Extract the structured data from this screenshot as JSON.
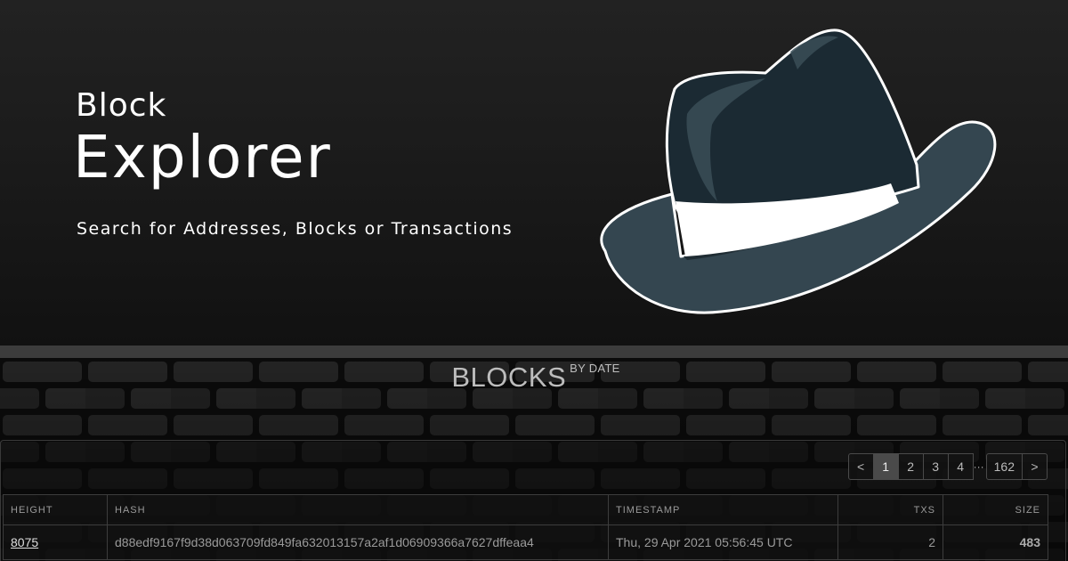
{
  "hero": {
    "title_line1": "Block",
    "title_line2": "Explorer",
    "subtitle": "Search for Addresses, Blocks or Transactions",
    "logo_icon": "fedora-hat-icon"
  },
  "blocks": {
    "heading": "BLOCKS",
    "heading_sup": "BY DATE",
    "pagination": {
      "prev": "<",
      "pages": [
        "1",
        "2",
        "3",
        "4"
      ],
      "active_page": "1",
      "ellipsis": "···",
      "last_page": "162",
      "next": ">"
    },
    "columns": {
      "height": "HEIGHT",
      "hash": "HASH",
      "timestamp": "TIMESTAMP",
      "txs": "TXS",
      "size": "SIZE"
    },
    "rows": [
      {
        "height": "8075",
        "hash": "d88edf9167f9d38d063709fd849fa632013157a2af1d06909366a7627dffeaa4",
        "timestamp": "Thu, 29 Apr 2021 05:56:45 UTC",
        "txs": "2",
        "size": "483"
      }
    ]
  },
  "colors": {
    "hat_crown": "#1b2a33",
    "hat_brim": "#344650",
    "hat_band": "#ffffff",
    "hero_bg": "#1b1b1b",
    "divider": "#3c3c3c"
  }
}
